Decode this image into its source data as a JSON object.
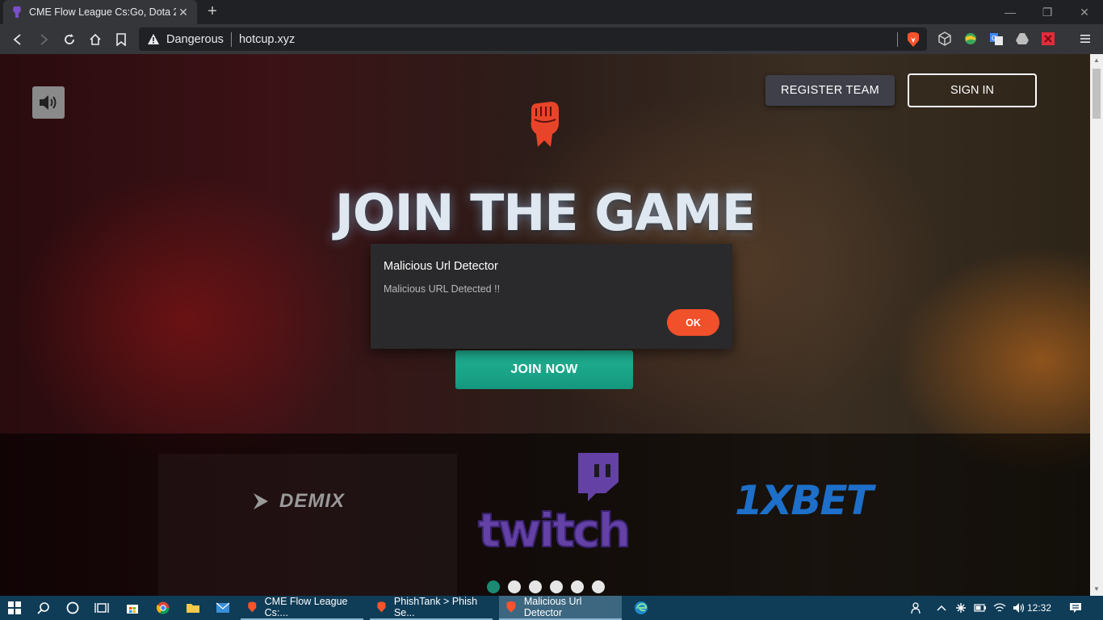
{
  "browser": {
    "tab_title": "CME Flow League Cs:Go, Dota 2, C",
    "security_label": "Dangerous",
    "url": "hotcup.xyz"
  },
  "page": {
    "register_label": "REGISTER TEAM",
    "signin_label": "SIGN IN",
    "headline": "JOIN THE GAME",
    "join_label": "JOIN NOW",
    "sponsors": [
      "DEMIX",
      "twitch",
      "1XBET"
    ],
    "carousel": {
      "count": 6,
      "active_index": 0
    }
  },
  "dialog": {
    "title": "Malicious Url Detector",
    "message": "Malicious URL Detected !!",
    "ok_label": "OK"
  },
  "taskbar": {
    "apps": [
      {
        "label": "CME Flow League Cs:...",
        "active": false
      },
      {
        "label": "PhishTank > Phish Se...",
        "active": false
      },
      {
        "label": "Malicious Url Detector",
        "active": true
      }
    ],
    "clock": "12:32"
  },
  "colors": {
    "accent_join": "#1aa88b",
    "ok_button": "#f0502a",
    "twitch": "#6441a5",
    "xbet": "#1d6fc9",
    "taskbar": "#0f3c57"
  },
  "icons": [
    "back-icon",
    "forward-icon",
    "reload-icon",
    "home-icon",
    "bookmark-icon",
    "warning-icon",
    "brave-icon",
    "speaker-icon",
    "fist-logo-icon",
    "windows-icon",
    "search-icon",
    "cortana-icon",
    "task-view-icon",
    "store-icon",
    "chrome-icon",
    "folder-icon",
    "mail-icon",
    "edge-icon"
  ]
}
